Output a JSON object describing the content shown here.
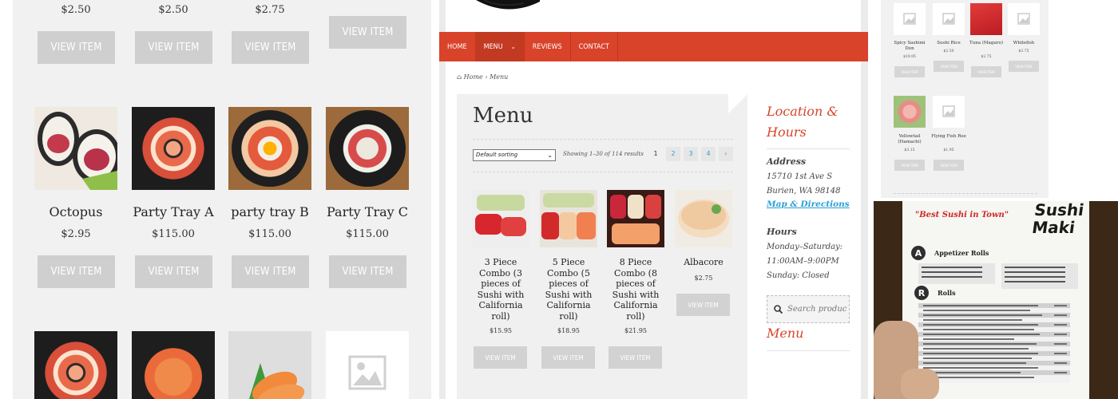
{
  "left_panel": {
    "top_row": [
      {
        "price": "$2.50",
        "button": "VIEW ITEM"
      },
      {
        "price": "$2.50",
        "button": "VIEW ITEM"
      },
      {
        "price": "$2.75",
        "button": "VIEW ITEM"
      },
      {
        "price": "",
        "button": "VIEW ITEM"
      }
    ],
    "mid_row": [
      {
        "title": "Octopus",
        "price": "$2.95",
        "button": "VIEW ITEM"
      },
      {
        "title": "Party Tray A",
        "price": "$115.00",
        "button": "VIEW ITEM"
      },
      {
        "title": "party tray B",
        "price": "$115.00",
        "button": "VIEW ITEM"
      },
      {
        "title": "Party Tray C",
        "price": "$115.00",
        "button": "VIEW ITEM"
      }
    ],
    "placeholder_icon": "image-placeholder-icon"
  },
  "middle_panel": {
    "nav": [
      {
        "label": "HOME"
      },
      {
        "label": "MENU",
        "active": true
      },
      {
        "label": "REVIEWS"
      },
      {
        "label": "CONTACT"
      }
    ],
    "breadcrumb": {
      "home": "Home",
      "sep": "›",
      "current": "Menu"
    },
    "page_title": "Menu",
    "sorting": {
      "selected": "Default sorting"
    },
    "result_count": "Showing 1–30 of 114 results",
    "pagination": {
      "current": "1",
      "pages": [
        "2",
        "3",
        "4"
      ],
      "next": "›"
    },
    "products": [
      {
        "title": "3 Piece Combo (3 pieces of Sushi with California roll)",
        "price": "$15.95",
        "button": "VIEW ITEM"
      },
      {
        "title": "5 Piece Combo (5 pieces of Sushi with California roll)",
        "price": "$18.95",
        "button": "VIEW ITEM"
      },
      {
        "title": "8 Piece Combo (8 pieces of Sushi with California roll)",
        "price": "$21.95",
        "button": "VIEW ITEM"
      },
      {
        "title": "Albacore",
        "price": "$2.75",
        "button": "VIEW ITEM"
      }
    ],
    "sidebar": {
      "location_heading": "Location & Hours",
      "address_label": "Address",
      "address_line1": "15710 1st Ave S",
      "address_line2": "Burien, WA 98148",
      "directions_link": "Map & Directions",
      "hours_label": "Hours",
      "hours_line1": "Monday–Saturday:",
      "hours_line2": "11:00AM–9:00PM",
      "hours_line3": "Sunday: Closed",
      "search_heading": "Search Our Menu",
      "search_placeholder": "Search products…"
    },
    "colors": {
      "accent": "#d8432a",
      "link": "#2a9fd6"
    }
  },
  "right_top_panel": {
    "row1": [
      {
        "title": "Spicy Sashimi Don",
        "price": "$19.95",
        "button": "VIEW ITEM"
      },
      {
        "title": "Sushi Rice",
        "price": "$2.50",
        "button": "VIEW ITEM"
      },
      {
        "title": "Tuna (Maguro)",
        "price": "$2.75",
        "button": "VIEW ITEM"
      },
      {
        "title": "Whitefish",
        "price": "$2.75",
        "button": "VIEW ITEM"
      }
    ],
    "row2": [
      {
        "title": "Yellowtail (Hamachi)",
        "price": "$3.15",
        "button": "VIEW ITEM"
      },
      {
        "title": "Flying Fish Roe",
        "price": "$1.95",
        "button": "VIEW ITEM"
      }
    ]
  },
  "photo": {
    "tagline": "\"Best Sushi in Town\"",
    "logo": "Sushi Maki",
    "section_a": {
      "letter": "A",
      "label": "Appetizer Rolls"
    },
    "section_r": {
      "letter": "R",
      "label": "Rolls"
    }
  }
}
